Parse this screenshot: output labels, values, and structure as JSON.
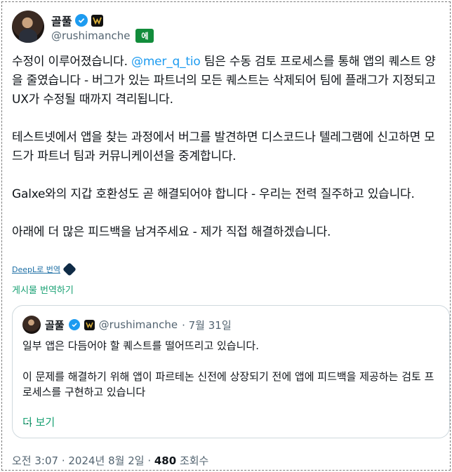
{
  "author": {
    "display_name": "골풀",
    "handle": "@rushimanche",
    "translate_chip": "에"
  },
  "post": {
    "paragraphs": [
      {
        "before": "수정이 이루어졌습니다. ",
        "mention": "@mer_q_tio",
        "after": " 팀은 수동 검토 프로세스를 통해 앱의 퀘스트 양을 줄였습니다 - 버그가 있는 파트너의 모든 퀘스트는 삭제되어 팀에 플래그가 지정되고 UX가 수정될 때까지 격리됩니다."
      },
      {
        "text": "테스트넷에서 앱을 찾는 과정에서 버그를 발견하면 디스코드나 텔레그램에 신고하면 모드가 파트너 팀과 커뮤니케이션을 중계합니다."
      },
      {
        "text": "Galxe와의 지갑 호환성도 곧 해결되어야 합니다 - 우리는 전력 질주하고 있습니다."
      },
      {
        "text": "아래에 더 많은 피드백을 남겨주세요 - 제가 직접 해결하겠습니다."
      }
    ],
    "deepl_label": "DeepL로 번역",
    "translate_post_label": "게시물 번역하기"
  },
  "quote": {
    "display_name": "골풀",
    "handle": "@rushimanche",
    "date": "· 7월 31일",
    "paragraphs": [
      "일부 앱은 다듬어야 할 퀘스트를 떨어뜨리고 있습니다.",
      "이 문제를 해결하기 위해 앱이 파르테논 신전에 상장되기 전에 앱에 피드백을 제공하는 검토 프로세스를 구현하고 있습니다"
    ],
    "ellipsis": "...",
    "show_more": "더 보기"
  },
  "meta": {
    "time_date": "오전 3:07 · 2024년 8월 2일 · ",
    "views_count": "480",
    "views_label": " 조회수"
  }
}
